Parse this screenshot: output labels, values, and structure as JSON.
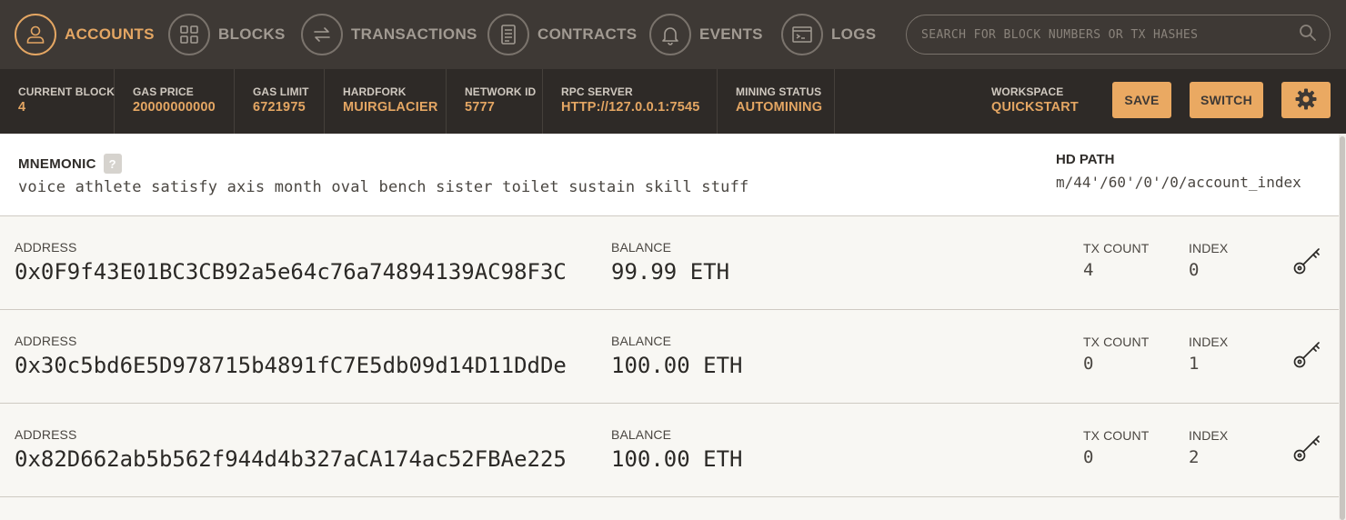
{
  "nav": {
    "items": [
      {
        "label": "ACCOUNTS",
        "icon": "user-icon",
        "active": true
      },
      {
        "label": "BLOCKS",
        "icon": "blocks-grid-icon",
        "active": false
      },
      {
        "label": "TRANSACTIONS",
        "icon": "transfer-arrows-icon",
        "active": false
      },
      {
        "label": "CONTRACTS",
        "icon": "document-icon",
        "active": false
      },
      {
        "label": "EVENTS",
        "icon": "bell-icon",
        "active": false
      },
      {
        "label": "LOGS",
        "icon": "terminal-icon",
        "active": false
      }
    ],
    "search_placeholder": "SEARCH FOR BLOCK NUMBERS OR TX HASHES"
  },
  "status": {
    "current_block": {
      "label": "CURRENT BLOCK",
      "value": "4"
    },
    "gas_price": {
      "label": "GAS PRICE",
      "value": "20000000000"
    },
    "gas_limit": {
      "label": "GAS LIMIT",
      "value": "6721975"
    },
    "hardfork": {
      "label": "HARDFORK",
      "value": "MUIRGLACIER"
    },
    "network_id": {
      "label": "NETWORK ID",
      "value": "5777"
    },
    "rpc_server": {
      "label": "RPC SERVER",
      "value": "HTTP://127.0.0.1:7545"
    },
    "mining_status": {
      "label": "MINING STATUS",
      "value": "AUTOMINING"
    },
    "workspace": {
      "label": "WORKSPACE",
      "value": "QUICKSTART"
    },
    "save_label": "SAVE",
    "switch_label": "SWITCH"
  },
  "mnemonic": {
    "label": "MNEMONIC",
    "help": "?",
    "words": "voice athlete satisfy axis month oval bench sister toilet sustain skill stuff",
    "hd_path_label": "HD PATH",
    "hd_path": "m/44'/60'/0'/0/account_index"
  },
  "accounts": {
    "address_label": "ADDRESS",
    "balance_label": "BALANCE",
    "tx_count_label": "TX COUNT",
    "index_label": "INDEX",
    "rows": [
      {
        "address": "0x0F9f43E01BC3CB92a5e64c76a74894139AC98F3C",
        "balance": "99.99 ETH",
        "tx_count": "4",
        "index": "0"
      },
      {
        "address": "0x30c5bd6E5D978715b4891fC7E5db09d14D11DdDe",
        "balance": "100.00 ETH",
        "tx_count": "0",
        "index": "1"
      },
      {
        "address": "0x82D662ab5b562f944d4b327aCA174ac52FBAe225",
        "balance": "100.00 ETH",
        "tx_count": "0",
        "index": "2"
      }
    ]
  },
  "colors": {
    "accent": "#e4a663",
    "nav_bg": "#3e3935",
    "status_bg": "#2e2a27"
  }
}
